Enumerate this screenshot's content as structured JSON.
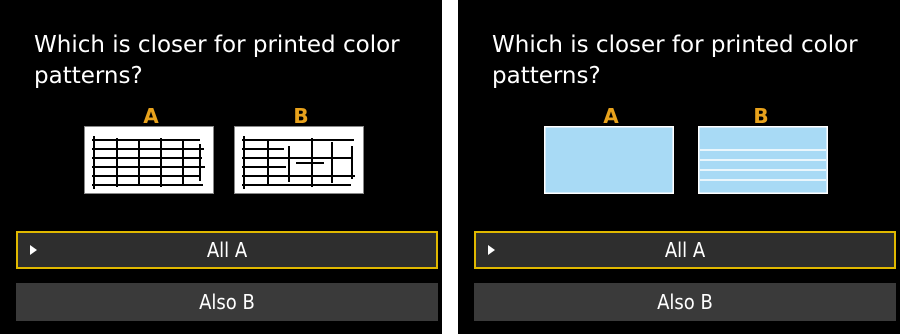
{
  "screens": [
    {
      "question": "Which is closer for printed color patterns?",
      "option_a": "A",
      "option_b": "B",
      "pattern_type": "grid-lines",
      "menu": [
        {
          "label": "All A",
          "selected": true
        },
        {
          "label": "Also B",
          "selected": false
        }
      ]
    },
    {
      "question": "Which is closer for printed color patterns?",
      "option_a": "A",
      "option_b": "B",
      "pattern_type": "solid-blue",
      "menu": [
        {
          "label": "All A",
          "selected": true
        },
        {
          "label": "Also B",
          "selected": false
        }
      ]
    }
  ],
  "colors": {
    "screen_bg": "#000000",
    "label_orange": "#e8a21c",
    "selection_border": "#e0b800",
    "menu_bg": "#3a3a3a",
    "pattern_blue": "#a8daf5"
  },
  "icons": {
    "cursor": "triangle-right-icon"
  }
}
